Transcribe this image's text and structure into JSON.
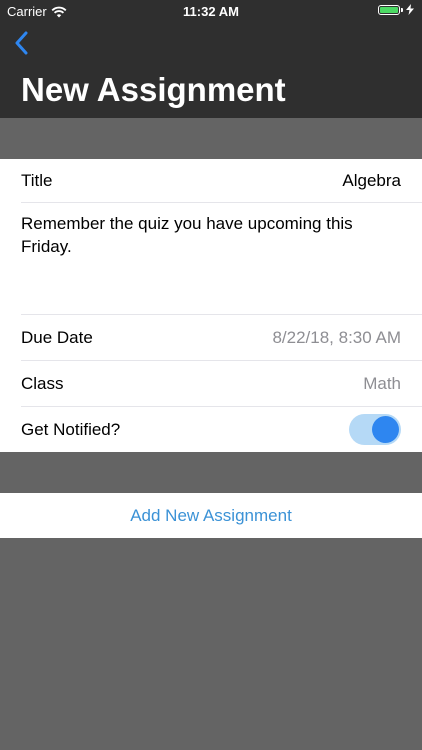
{
  "status_bar": {
    "carrier": "Carrier",
    "time": "11:32 AM",
    "battery_color": "#4cd964"
  },
  "nav": {
    "back_icon": "chevron-left-icon",
    "title": "New Assignment",
    "back_color": "#2e86f0"
  },
  "form": {
    "title_label": "Title",
    "title_value": "Algebra",
    "note": "Remember the quiz you have upcoming this Friday.",
    "due_label": "Due Date",
    "due_value": "8/22/18, 8:30 AM",
    "class_label": "Class",
    "class_value": "Math",
    "notify_label": "Get Notified?",
    "notify_on": true
  },
  "actions": {
    "add_label": "Add New Assignment",
    "accent": "#3b92d6"
  }
}
